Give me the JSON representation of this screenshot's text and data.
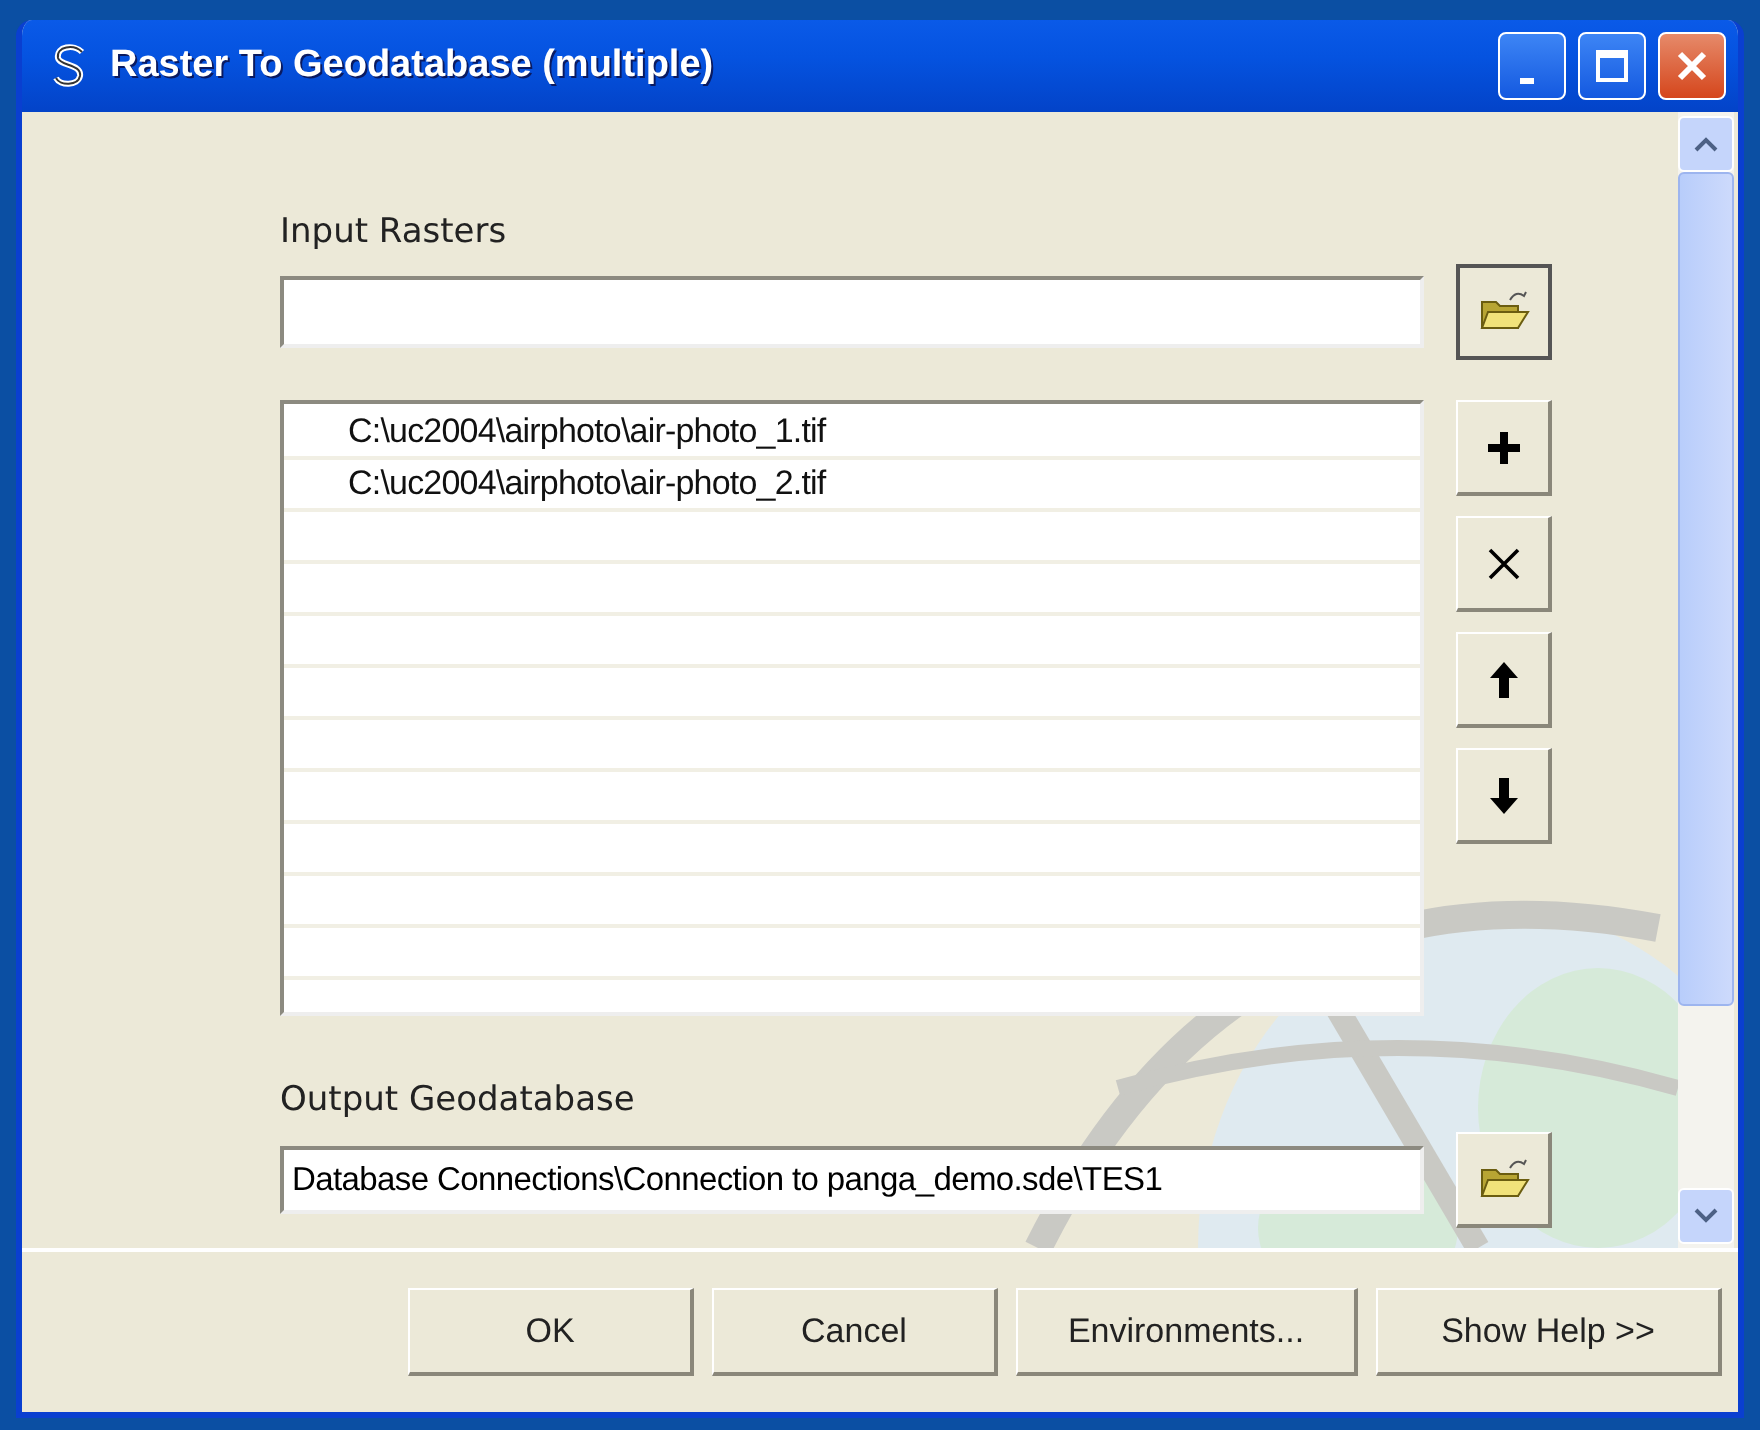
{
  "window": {
    "title": "Raster To Geodatabase (multiple)"
  },
  "input_rasters": {
    "label": "Input Rasters",
    "items": [
      "C:\\uc2004\\airphoto\\air-photo_1.tif",
      "C:\\uc2004\\airphoto\\air-photo_2.tif"
    ]
  },
  "output_geodatabase": {
    "label": "Output Geodatabase",
    "value": "Database Connections\\Connection to panga_demo.sde\\TES1"
  },
  "buttons": [
    "OK",
    "Cancel",
    "Environments...",
    "Show Help >>"
  ]
}
